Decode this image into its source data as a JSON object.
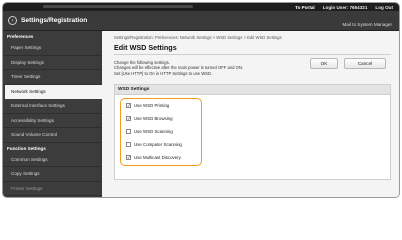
{
  "topbar": {
    "portal_label": "To Portal",
    "login_user_label": "Login User: 7654321",
    "logout_label": "Log Out"
  },
  "header": {
    "title": "Settings/Registration",
    "mail_link": "Mail to System Manager"
  },
  "sidebar": {
    "preferences_label": "Preferences",
    "preferences_items": [
      {
        "label": "Paper Settings"
      },
      {
        "label": "Display Settings"
      },
      {
        "label": "Timer Settings"
      },
      {
        "label": "Network Settings"
      },
      {
        "label": "External Interface Settings"
      },
      {
        "label": "Accessibility Settings"
      },
      {
        "label": "Sound Volume Control"
      }
    ],
    "function_label": "Function Settings",
    "function_items": [
      {
        "label": "Common Settings"
      },
      {
        "label": "Copy Settings"
      },
      {
        "label": "Printer Settings"
      }
    ]
  },
  "content": {
    "breadcrumb": "Settings/Registration: Preferences: Network Settings > WSD Settings > Edit WSD Settings",
    "title": "Edit WSD Settings",
    "instructions": [
      "Change the following settings.",
      "Changes will be effective after the main power is turned OFF and ON.",
      "Set [Use HTTP] to On in HTTP Settings to use WSD."
    ],
    "ok_label": "OK",
    "cancel_label": "Cancel",
    "panel_title": "WSD Settings",
    "options": [
      {
        "label": "Use WSD Printing",
        "checked": true
      },
      {
        "label": "Use WSD Browsing",
        "checked": true
      },
      {
        "label": "Use WSD Scanning",
        "checked": false
      },
      {
        "label": "Use Computer Scanning",
        "checked": false
      },
      {
        "label": "Use Multicast Discovery",
        "checked": true
      }
    ]
  },
  "colors": {
    "highlight": "#f39b1a",
    "sidebar_bg": "#3c3c3c",
    "header_bg": "#3a3a3a"
  }
}
